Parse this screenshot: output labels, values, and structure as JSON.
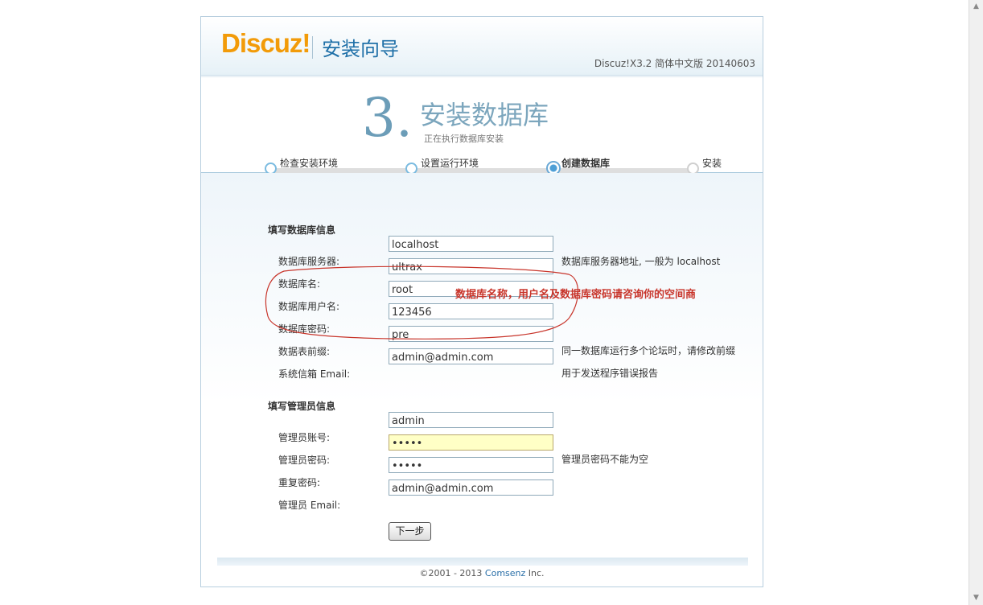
{
  "header": {
    "logo": "Discuz!",
    "title": "安装向导",
    "version": "Discuz!X3.2 简体中文版 20140603"
  },
  "step": {
    "number": "3.",
    "title": "安装数据库",
    "subtitle": "正在执行数据库安装",
    "steps": [
      {
        "label": "检查安装环境",
        "state": "done"
      },
      {
        "label": "设置运行环境",
        "state": "done"
      },
      {
        "label": "创建数据库",
        "state": "current"
      },
      {
        "label": "安装",
        "state": "pending"
      }
    ]
  },
  "db_section": {
    "title": "填写数据库信息",
    "rows": [
      {
        "label": "数据库服务器:",
        "value": "localhost",
        "hint": "数据库服务器地址, 一般为 localhost"
      },
      {
        "label": "数据库名:",
        "value": "ultrax",
        "hint": ""
      },
      {
        "label": "数据库用户名:",
        "value": "root",
        "hint": ""
      },
      {
        "label": "数据库密码:",
        "value": "123456",
        "hint": ""
      },
      {
        "label": "数据表前缀:",
        "value": "pre",
        "hint": "同一数据库运行多个论坛时，请修改前缀"
      },
      {
        "label": "系统信箱 Email:",
        "value": "admin@admin.com",
        "hint": "用于发送程序错误报告"
      }
    ]
  },
  "annotation": {
    "text": "数据库名称，用户名及数据库密码请咨询你的空间商",
    "color": "#c8352b"
  },
  "admin_section": {
    "title": "填写管理员信息",
    "rows": [
      {
        "label": "管理员账号:",
        "value": "admin",
        "hint": ""
      },
      {
        "label": "管理员密码:",
        "value": "•••••",
        "hint": "管理员密码不能为空"
      },
      {
        "label": "重复密码:",
        "value": "•••••",
        "hint": ""
      },
      {
        "label": "管理员 Email:",
        "value": "admin@admin.com",
        "hint": ""
      }
    ]
  },
  "next_button": "下一步",
  "footer": {
    "copyright_prefix": "©2001 - 2013 ",
    "company": "Comsenz",
    "suffix": " Inc."
  },
  "colors": {
    "logo": "#f29b09",
    "title": "#1f70a8",
    "annotation": "#c8352b",
    "highlight_field": "#ffffc6"
  }
}
